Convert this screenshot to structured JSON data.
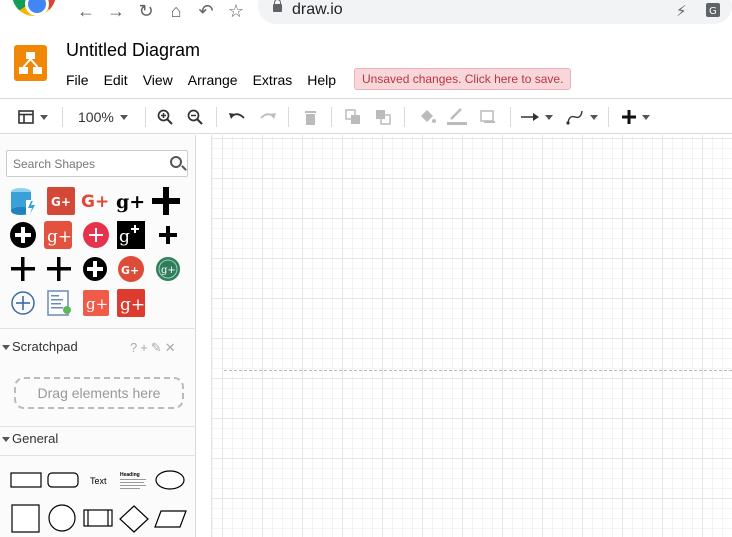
{
  "browser": {
    "url": "draw.io",
    "nav": [
      "back-icon",
      "forward-icon",
      "reload-icon",
      "home-icon",
      "history-icon",
      "bookmark-star-icon"
    ],
    "extensions": [
      "lightning-icon",
      "translate-icon"
    ]
  },
  "app": {
    "title": "Untitled Diagram",
    "menu": [
      "File",
      "Edit",
      "View",
      "Arrange",
      "Extras",
      "Help"
    ],
    "unsaved_notice": "Unsaved changes. Click here to save.",
    "accent": "#f08705",
    "notice_bg": "#f8d7da",
    "notice_fg": "#b9353f"
  },
  "toolbar": {
    "zoom": "100%",
    "icons": [
      "view-icon",
      "zoom-in-icon",
      "zoom-out-icon",
      "undo-icon",
      "redo-icon",
      "delete-icon",
      "to-front-icon",
      "to-back-icon",
      "fill-color-icon",
      "line-color-icon",
      "shadow-icon",
      "connection-icon",
      "waypoints-icon",
      "insert-icon"
    ]
  },
  "sidebar": {
    "search_placeholder": "Search Shapes",
    "search_results": [
      "azure-storage",
      "google-plus-red-square",
      "google-plus-text",
      "google-plus-black",
      "plus-black",
      "plus-circle-black",
      "google-plus-square-red",
      "plus-circle-red",
      "google-plus-square-black",
      "plus-black-small",
      "plus-thin",
      "plus-bold",
      "plus-circle-black-2",
      "google-plus-circle-red",
      "google-plus-circle-green",
      "plus-circle-outline",
      "document-icon",
      "google-plus-square-red-2",
      "google-plus-square-red-3"
    ],
    "scratchpad": {
      "title": "Scratchpad",
      "tools": [
        "?",
        "+",
        "✎",
        "✕"
      ],
      "dropzone": "Drag elements here"
    },
    "general": {
      "title": "General",
      "text_shape_label": "Text",
      "heading_shape_label": "Heading"
    }
  }
}
